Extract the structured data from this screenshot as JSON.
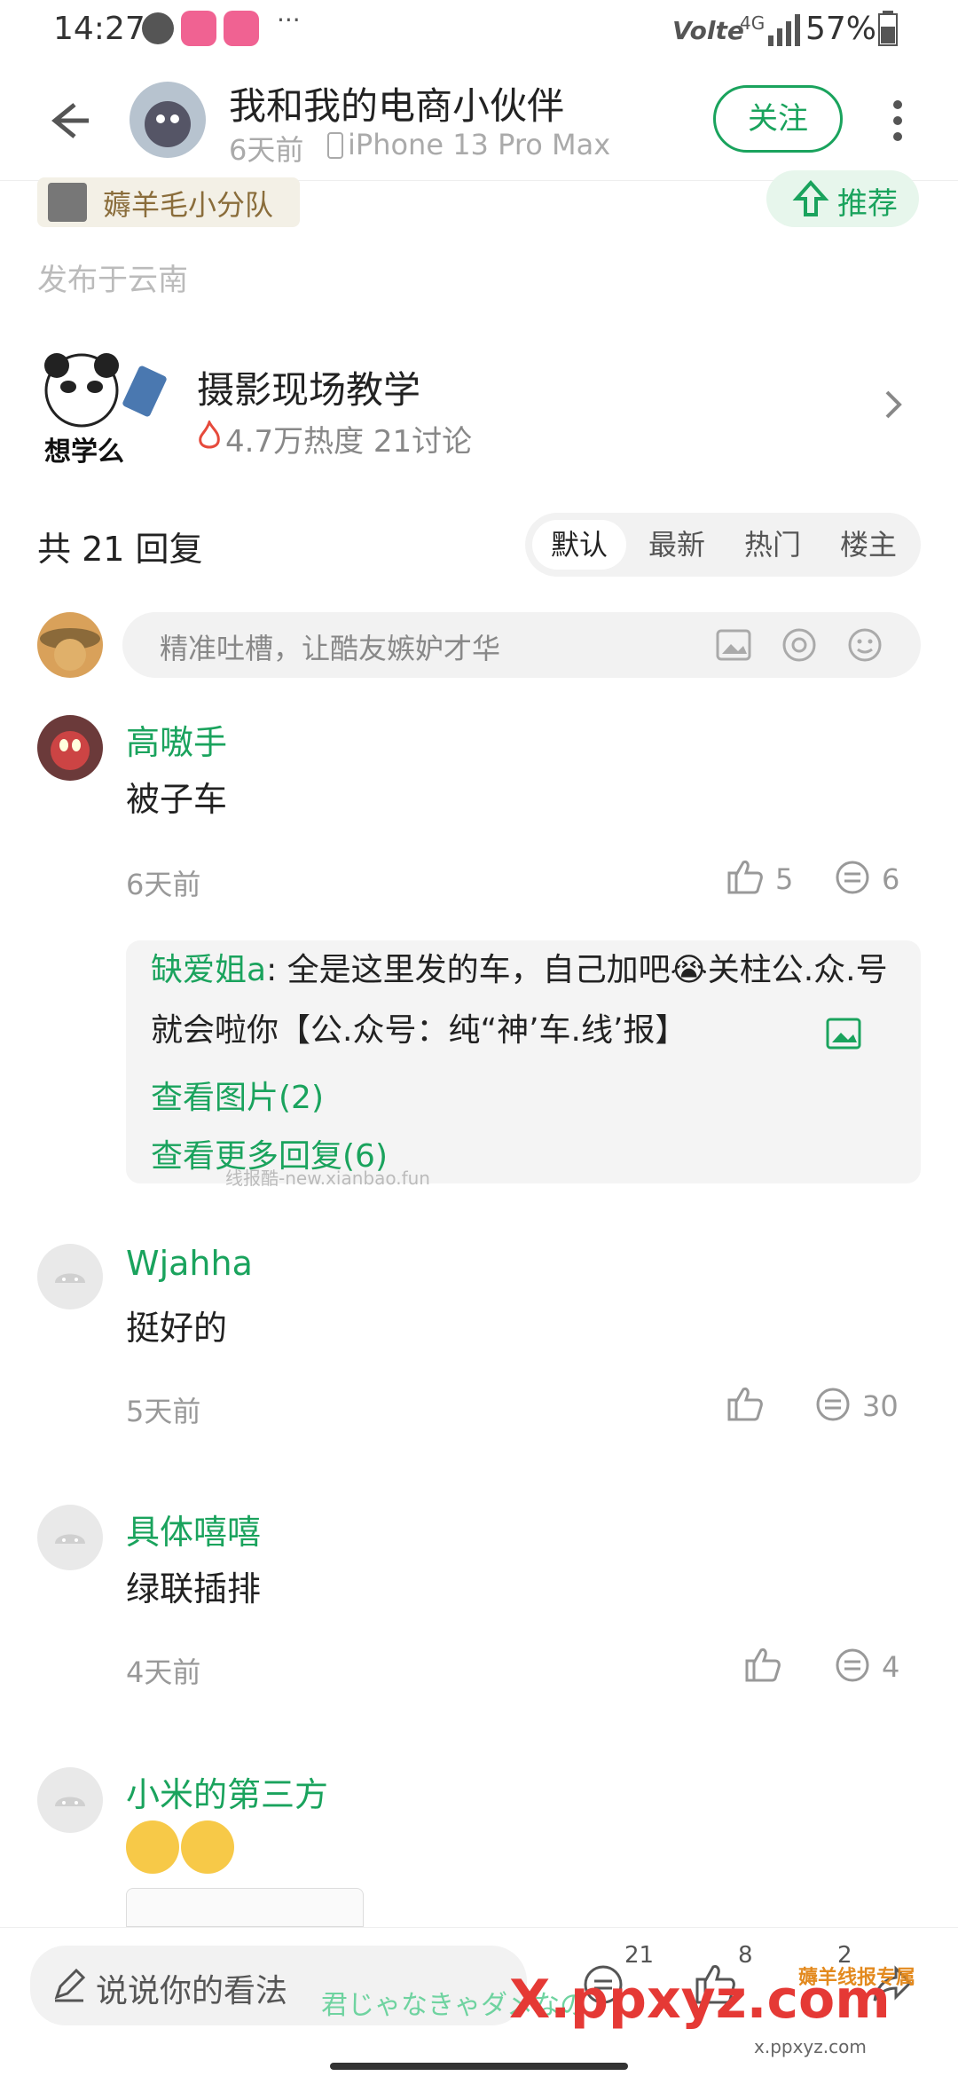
{
  "status_bar": {
    "time": "14:27",
    "dots": "···",
    "network": "Volte",
    "signal_label": "4G",
    "battery": "57%"
  },
  "header": {
    "title": "我和我的电商小伙伴",
    "subtitle_time": "6天前",
    "device": "iPhone 13 Pro Max",
    "follow_label": "关注"
  },
  "post": {
    "topic_tag": "薅羊毛小分队",
    "recommend_label": "推荐",
    "location": "发布于云南"
  },
  "topic_card": {
    "title": "摄影现场教学",
    "heat": "4.7万热度 21讨论",
    "meme_text": "想学么"
  },
  "replies_header": {
    "count_text": "共 21 回复",
    "tabs": [
      "默认",
      "最新",
      "热门",
      "楼主"
    ],
    "active_tab": 0
  },
  "comment_input": {
    "placeholder": "精准吐槽，让酷友嫉妒才华"
  },
  "comments": [
    {
      "user": "高嗷手",
      "text": "被子车",
      "time": "6天前",
      "likes": "5",
      "replies": "6",
      "sub": {
        "user": "缺爱姐a",
        "text": ": 全是这里发的车，自己加吧😭关柱公.众.号就会啦你【公.众号：纯“神’车.线’报】",
        "view_images": "查看图片(2)",
        "more_replies": "查看更多回复(6)",
        "watermark": "线报酷-new.xianbao.fun"
      }
    },
    {
      "user": "Wjahha",
      "text": "挺好的",
      "time": "5天前",
      "likes": "",
      "replies": "30"
    },
    {
      "user": "具体嘻嘻",
      "text": "绿联插排",
      "time": "4天前",
      "likes": "",
      "replies": "4"
    },
    {
      "user": "小米的第三方",
      "text": "",
      "time": "",
      "likes": "",
      "replies": ""
    }
  ],
  "bottom_bar": {
    "input_label": "说说你的看法",
    "comments": "21",
    "likes": "8",
    "shares": "2",
    "overlay_text": "君じゃなきゃダメなの",
    "brand_watermark": "X.ppxyz.com",
    "brand_sub": "x.ppxyz.com",
    "corner_watermark": "薅羊线报专属"
  }
}
